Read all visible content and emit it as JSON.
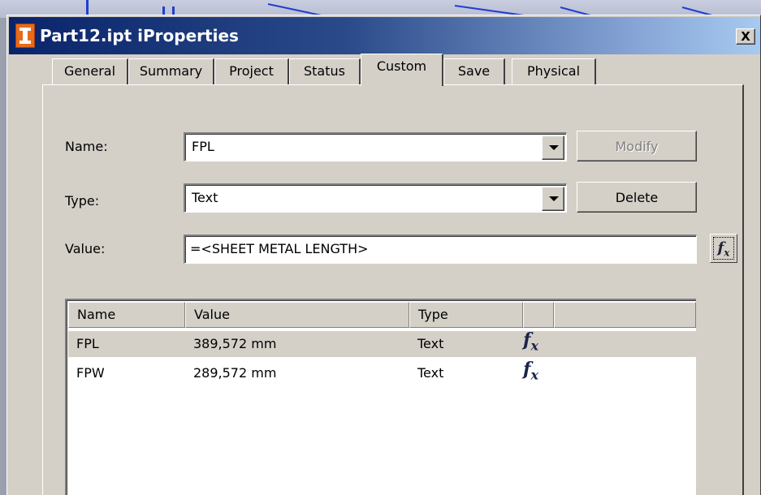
{
  "window": {
    "title": "Part12.ipt iProperties",
    "close_label": "X"
  },
  "tabs": [
    {
      "label": "General"
    },
    {
      "label": "Summary"
    },
    {
      "label": "Project"
    },
    {
      "label": "Status"
    },
    {
      "label": "Custom",
      "active": true
    },
    {
      "label": "Save"
    },
    {
      "label": "Physical"
    }
  ],
  "form": {
    "name_label": "Name:",
    "name_value": "FPL",
    "type_label": "Type:",
    "type_value": "Text",
    "value_label": "Value:",
    "value_value": "=<SHEET METAL LENGTH>",
    "modify_label": "Modify",
    "delete_label": "Delete",
    "fx_icon": "fx-icon"
  },
  "list": {
    "headers": [
      "Name",
      "Value",
      "Type",
      ""
    ],
    "rows": [
      {
        "name": "FPL",
        "value": "389,572 mm",
        "type": "Text",
        "icon": "fx-icon",
        "selected": true
      },
      {
        "name": "FPW",
        "value": "289,572 mm",
        "type": "Text",
        "icon": "fx-icon",
        "selected": false
      }
    ]
  },
  "colors": {
    "titlebar_start": "#0a246a",
    "titlebar_end": "#a6caf0",
    "dialog_face": "#d4d0c8",
    "background_lines": "#1f3fd0"
  }
}
